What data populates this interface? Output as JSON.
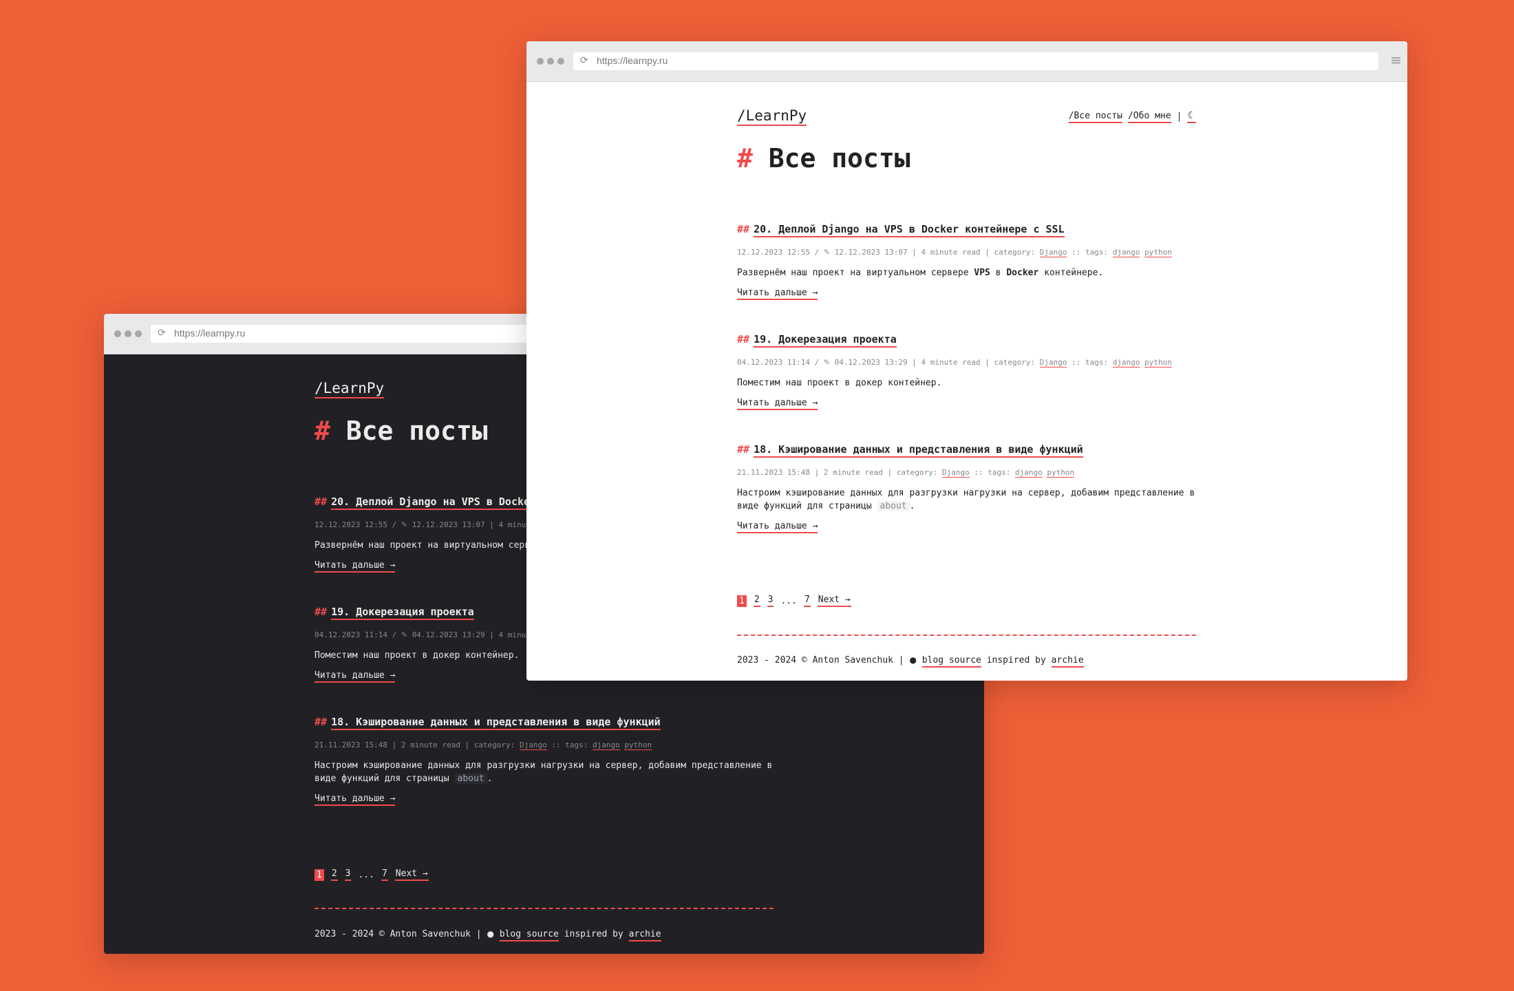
{
  "browser": {
    "url": "https://learnpy.ru"
  },
  "site": {
    "logo": "/LearnPy",
    "nav": {
      "all_posts": "/Все посты",
      "about": "/Обо мне",
      "separator": "|"
    },
    "page_title": "Все посты",
    "title_hash": "#",
    "post_hash": "##"
  },
  "posts": [
    {
      "title": "20. Деплой Django на VPS в Docker контейнере с SSL",
      "created": "12.12.2023 12:55",
      "updated": "12.12.2023 13:07",
      "read_time": "4 minute read",
      "category_label": "category:",
      "category": "Django",
      "tags_label": ":: tags:",
      "tags": [
        "django",
        "python"
      ],
      "excerpt_before": "Развернём наш проект на виртуальном сервере ",
      "excerpt_bold1": "VPS",
      "excerpt_mid": " в ",
      "excerpt_bold2": "Docker",
      "excerpt_after": " контейнере.",
      "read_more": "Читать дальше →"
    },
    {
      "title": "19. Докерезация проекта",
      "created": "04.12.2023 11:14",
      "updated": "04.12.2023 13:29",
      "read_time": "4 minute read",
      "category_label": "category:",
      "category": "Django",
      "tags_label": ":: tags:",
      "tags": [
        "django",
        "python"
      ],
      "excerpt": "Поместим наш проект в докер контейнер.",
      "read_more": "Читать дальше →"
    },
    {
      "title": "18. Кэширование данных и представления в виде функций",
      "created": "21.11.2023 15:48",
      "read_time": "2 minute read",
      "category_label": "category:",
      "category": "Django",
      "tags_label": ":: tags:",
      "tags": [
        "django",
        "python"
      ],
      "excerpt": "Настроим кэширование данных для разгрузки нагрузки на сервер, добавим представление в виде функций для страницы",
      "excerpt_code": "about",
      "excerpt_end": ".",
      "read_more": "Читать дальше →"
    }
  ],
  "pagination": {
    "pages": [
      "1",
      "2",
      "3"
    ],
    "ellipsis": "...",
    "last": "7",
    "next": "Next →",
    "current": 1
  },
  "footer": {
    "copyright": "2023 - 2024 © Anton Savenchuk |",
    "source_link": "blog source",
    "inspired": "inspired by",
    "inspired_link": "archie"
  },
  "icons": {
    "reload": "reload-icon",
    "menu": "hamburger-menu-icon",
    "theme": "moon-icon",
    "edit": "pencil-icon",
    "github": "github-icon"
  },
  "colors": {
    "background": "#EE5E37",
    "accent": "#EF4B4B",
    "dark_page": "#212125",
    "light_page": "#ffffff"
  }
}
